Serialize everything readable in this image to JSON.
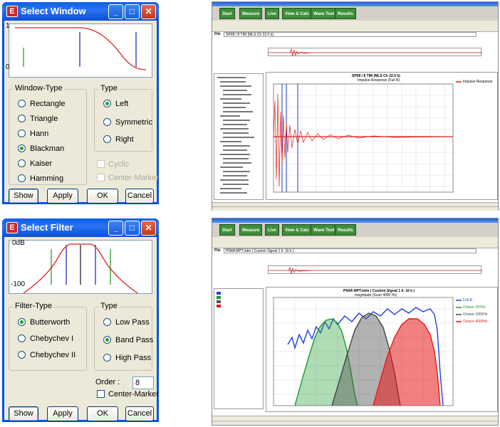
{
  "window_dialog": {
    "title": "Select Window",
    "plot_top_label": "1",
    "plot_bottom_label": "0",
    "window_type_label": "Window-Type",
    "window_types": [
      "Rectangle",
      "Triangle",
      "Hann",
      "Blackman",
      "Kaiser",
      "Hamming"
    ],
    "selected_window_type": "Blackman",
    "type_label": "Type",
    "types": [
      "Left",
      "Symmetric",
      "Right"
    ],
    "selected_type": "Left",
    "cyclic_label": "Cyclic",
    "center_marker_label": "Center-Marker",
    "buttons": {
      "show": "Show",
      "apply": "Apply",
      "ok": "OK",
      "cancel": "Cancel"
    }
  },
  "filter_dialog": {
    "title": "Select Filter",
    "plot_top_label": "0dB",
    "plot_bottom_label": "-100",
    "filter_type_label": "Filter-Type",
    "filter_types": [
      "Butterworth",
      "Chebychev I",
      "Chebychev II"
    ],
    "selected_filter_type": "Butterworth",
    "type_label": "Type",
    "types": [
      "Low Pass",
      "Band Pass",
      "High Pass"
    ],
    "selected_type": "Band Pass",
    "order_label": "Order :",
    "order_value": "8",
    "center_marker_label": "Center-Marker",
    "buttons": {
      "show": "Show",
      "apply": "Apply",
      "ok": "OK",
      "cancel": "Cancel"
    }
  },
  "app_top": {
    "toolbar": [
      "Start",
      "Measure",
      "Live",
      "View & Calc",
      "Wave Tool",
      "Results"
    ],
    "file_label": "File",
    "file_name": "SP08 / 8 TIM (MLS Ch 22.0 k)",
    "chart_title": "SP08 / 8 TIM (MLS Ch 22.0 k)",
    "chart_subtitle": "Impulse Response (Full R)",
    "legend": [
      "Impulse Response"
    ],
    "colors": {
      "trace": "#e0201e",
      "marker": "#1f3fbf"
    }
  },
  "app_bottom": {
    "toolbar": [
      "Start",
      "Measure",
      "Live",
      "View & Calc",
      "Wave Tool",
      "Results"
    ],
    "file_label": "File",
    "file_name": "PN4A MPT.mtm ( Custom Signal 1 k: 16 k )",
    "chart_title": "PN4A MPT.mtm ( Custom Signal 1 k: 16 k )",
    "chart_subtitle": "magnitude (Scan 4000 Hz)",
    "legend": [
      "Full R",
      "Octave 250Hz",
      "Octave 1000Hz",
      "Octave 4000Hz"
    ],
    "colors": {
      "full": "#1f3fe0",
      "oct250": "#1a9a2a",
      "oct1000": "#555555",
      "oct4000": "#e81818"
    }
  }
}
